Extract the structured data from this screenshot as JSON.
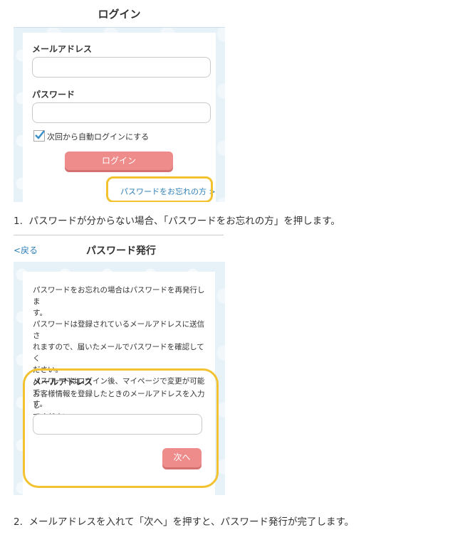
{
  "login": {
    "title": "ログイン",
    "email_label": "メールアドレス",
    "password_label": "パスワード",
    "auto_login_label": "次回から自動ログインにする",
    "auto_login_checked": true,
    "login_button": "ログイン",
    "forgot_link": "パスワードをお忘れの方 >"
  },
  "step1": {
    "caption": "1.  パスワードが分からない場合、「パスワードをお忘れの方」を押します。"
  },
  "reissue": {
    "back_label": "<戻る",
    "title": "パスワード発行",
    "intro_lines": [
      "パスワードをお忘れの場合はパスワードを再発行しま",
      "す。",
      "パスワードは登録されているメールアドレスに送信さ",
      "れますので、届いたメールでパスワードを確認してく",
      "ださい。",
      "パスワードはログイン後、マイページで変更が可能で",
      "す。"
    ],
    "email_label": "メールアドレス",
    "email_help_lines": [
      "お客様情報を登録したときのメールアドレスを入力し",
      "てください。"
    ],
    "next_button": "次へ"
  },
  "step2": {
    "caption": "2.  メールアドレスを入れて「次へ」を押すと、パスワード発行が完了します。"
  },
  "colors": {
    "accent_pink": "#ee8c8c",
    "highlight_yellow": "#f2c230",
    "link_blue": "#2f7fb8"
  }
}
